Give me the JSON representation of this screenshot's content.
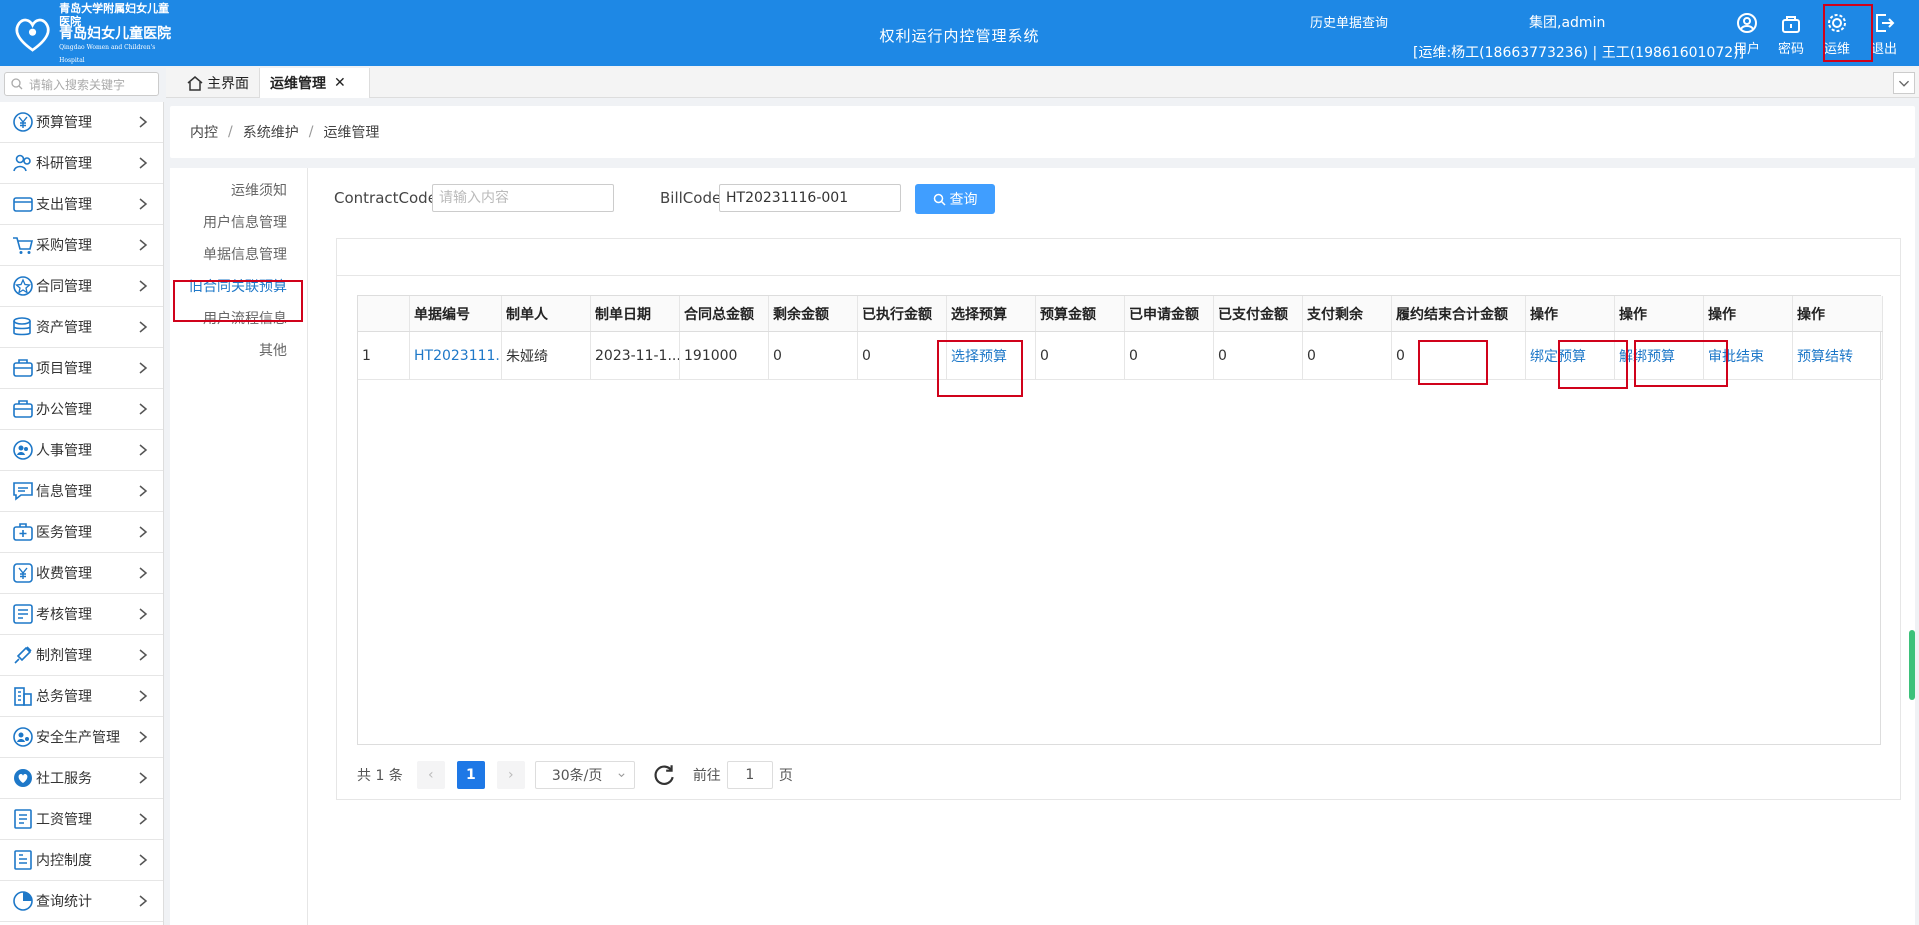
{
  "header": {
    "logo_line1": "青岛大学附属妇女儿童医院",
    "logo_line2": "青岛妇女儿童医院",
    "logo_line3": "Qingdao Women and Children's Hospital",
    "system_title": "权利运行内控管理系统",
    "history_link": "历史单据查询",
    "user_info": "集团,admin",
    "contacts": "[运维:杨工(18663773236) | 王工(19861601072)]",
    "buttons": {
      "user": "用户",
      "password": "密码",
      "ops": "运维",
      "exit": "退出"
    }
  },
  "sidebar": {
    "search_placeholder": "请输入搜索关键字",
    "items": [
      {
        "label": "预算管理",
        "icon": "yen-circle-icon"
      },
      {
        "label": "科研管理",
        "icon": "people-icon"
      },
      {
        "label": "支出管理",
        "icon": "card-icon"
      },
      {
        "label": "采购管理",
        "icon": "cart-icon"
      },
      {
        "label": "合同管理",
        "icon": "badge-icon"
      },
      {
        "label": "资产管理",
        "icon": "database-icon"
      },
      {
        "label": "项目管理",
        "icon": "briefcase-icon"
      },
      {
        "label": "办公管理",
        "icon": "briefcase-icon"
      },
      {
        "label": "人事管理",
        "icon": "users-icon"
      },
      {
        "label": "信息管理",
        "icon": "message-icon"
      },
      {
        "label": "医务管理",
        "icon": "medical-kit-icon"
      },
      {
        "label": "收费管理",
        "icon": "yen-icon"
      },
      {
        "label": "考核管理",
        "icon": "checklist-icon"
      },
      {
        "label": "制剂管理",
        "icon": "syringe-icon"
      },
      {
        "label": "总务管理",
        "icon": "building-icon"
      },
      {
        "label": "安全生产管理",
        "icon": "safety-icon"
      },
      {
        "label": "社工服务",
        "icon": "heart-icon"
      },
      {
        "label": "工资管理",
        "icon": "document-icon"
      },
      {
        "label": "内控制度",
        "icon": "policy-icon"
      },
      {
        "label": "查询统计",
        "icon": "pie-chart-icon"
      }
    ]
  },
  "tabs": {
    "home": "主界面",
    "active": "运维管理",
    "close": "✕"
  },
  "breadcrumb": [
    "内控",
    "系统维护",
    "运维管理"
  ],
  "subnav": [
    "运维须知",
    "用户信息管理",
    "单据信息管理",
    "旧合同关联预算",
    "用户流程信息",
    "其他"
  ],
  "filter": {
    "contract_label": "ContractCode",
    "contract_placeholder": "请输入内容",
    "bill_label": "BillCode",
    "bill_value": "HT20231116-001",
    "query_button": "查询"
  },
  "table": {
    "headers": [
      "",
      "单据编号",
      "制单人",
      "制单日期",
      "合同总金额",
      "剩余金额",
      "已执行金额",
      "选择预算",
      "预算金额",
      "已申请金额",
      "已支付金额",
      "支付剩余",
      "履约结束合计金额",
      "操作",
      "操作",
      "操作",
      "操作"
    ],
    "rows": [
      [
        "1",
        "HT2023111...",
        "朱娅绮",
        "2023-11-1...",
        "191000",
        "0",
        "0",
        "选择预算",
        "0",
        "0",
        "0",
        "0",
        "0",
        "绑定预算",
        "解绑预算",
        "审批结束",
        "预算结转"
      ]
    ]
  },
  "pagination": {
    "total": "共 1 条",
    "prev": "‹",
    "current": "1",
    "next": "›",
    "page_size": "30条/页",
    "goto_label": "前往",
    "goto_value": "1",
    "page_unit": "页"
  },
  "colors": {
    "header_bg": "#1e88e5",
    "accent": "#409eff",
    "link": "#1e78c8",
    "highlight": "#d0021b"
  }
}
